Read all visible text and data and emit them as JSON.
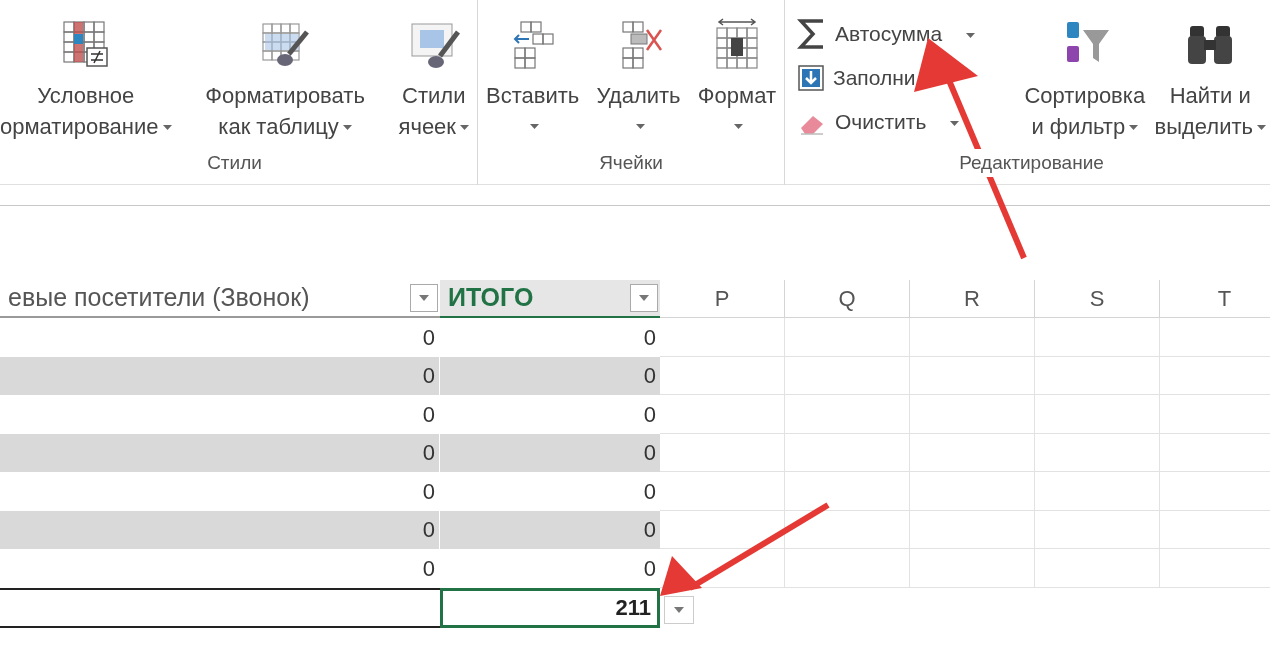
{
  "ribbon": {
    "groups": [
      {
        "label": "Стили",
        "buttons": [
          {
            "kind": "large",
            "lines": [
              "Условное",
              "орматирование"
            ],
            "dropdown": true
          },
          {
            "kind": "large",
            "lines": [
              "Форматировать",
              "как таблицу"
            ],
            "dropdown": true
          },
          {
            "kind": "large",
            "lines": [
              "Стили",
              "ячеек"
            ],
            "dropdown": true
          }
        ]
      },
      {
        "label": "Ячейки",
        "buttons": [
          {
            "kind": "large",
            "lines": [
              "Вставить"
            ],
            "dropdown": true
          },
          {
            "kind": "large",
            "lines": [
              "Удалить"
            ],
            "dropdown": true
          },
          {
            "kind": "large",
            "lines": [
              "Формат"
            ],
            "dropdown": true
          }
        ]
      },
      {
        "label": "Редактирование",
        "buttons": [
          {
            "kind": "small",
            "lines": [
              "Автосумма"
            ],
            "dropdown": true
          },
          {
            "kind": "small",
            "lines": [
              "Заполни"
            ],
            "dropdown": false
          },
          {
            "kind": "small",
            "lines": [
              "Очистить"
            ],
            "dropdown": true
          },
          {
            "kind": "large",
            "lines": [
              "Сортировка",
              "и фильтр"
            ],
            "dropdown": true
          },
          {
            "kind": "large",
            "lines": [
              "Найти и",
              "выделить"
            ],
            "dropdown": true
          }
        ]
      }
    ]
  },
  "sheet": {
    "columns": [
      {
        "kind": "table",
        "label": "евые посетители (Звонок)",
        "selected": false
      },
      {
        "kind": "table",
        "label": "ИТОГО",
        "selected": true
      },
      {
        "kind": "letter",
        "label": "P",
        "selected": false
      },
      {
        "kind": "letter",
        "label": "Q",
        "selected": false
      },
      {
        "kind": "letter",
        "label": "R",
        "selected": false
      },
      {
        "kind": "letter",
        "label": "S",
        "selected": false
      },
      {
        "kind": "letter",
        "label": "T",
        "selected": false
      }
    ],
    "rows": [
      {
        "values": [
          "0",
          "0"
        ],
        "shaded": false
      },
      {
        "values": [
          "0",
          "0"
        ],
        "shaded": true
      },
      {
        "values": [
          "0",
          "0"
        ],
        "shaded": false
      },
      {
        "values": [
          "0",
          "0"
        ],
        "shaded": true
      },
      {
        "values": [
          "0",
          "0"
        ],
        "shaded": false
      },
      {
        "values": [
          "0",
          "0"
        ],
        "shaded": true
      },
      {
        "values": [
          "0",
          "0"
        ],
        "shaded": false
      }
    ],
    "total": {
      "value": "211",
      "selected": true
    }
  }
}
